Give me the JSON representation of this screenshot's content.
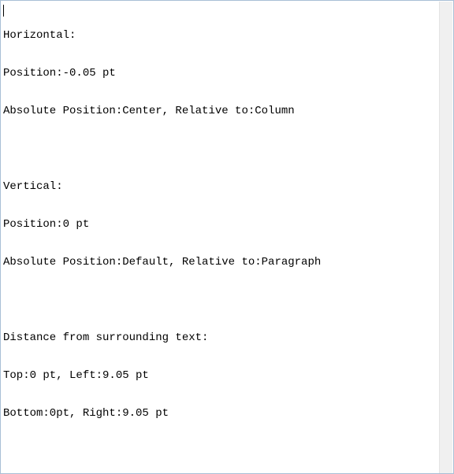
{
  "editor": {
    "lines": [
      "Horizontal:",
      "Position:-0.05 pt",
      "Absolute Position:Center, Relative to:Column",
      "",
      "Vertical:",
      "Position:0 pt",
      "Absolute Position:Default, Relative to:Paragraph",
      "",
      "Distance from surrounding text:",
      "Top:0 pt, Left:9.05 pt",
      "Bottom:0pt, Right:9.05 pt"
    ]
  }
}
